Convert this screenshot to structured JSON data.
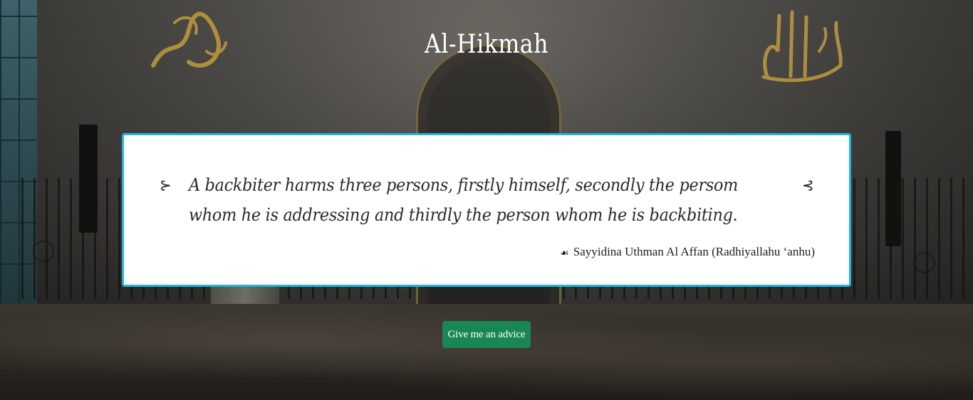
{
  "app": {
    "title": "Al-Hikmah"
  },
  "quote": {
    "open_mark": "⊱",
    "text": "A backbiter harms three persons, firstly himself, secondly the persom whom he is addressing and thirdly the person whom he is backbiting.",
    "close_mark": "⊰",
    "author_icon": "☙",
    "author": "Sayyidina Uthman Al Affan (Radhiyallahu ‘anhu)"
  },
  "actions": {
    "advice_button_label": "Give me an advice"
  },
  "colors": {
    "card_border": "#1fb6dc",
    "button_bg": "#198754",
    "title_text": "#ffffff"
  },
  "icons": {
    "open_quote": "open-quote-icon",
    "close_quote": "close-quote-icon",
    "author": "author-flourish-icon"
  }
}
